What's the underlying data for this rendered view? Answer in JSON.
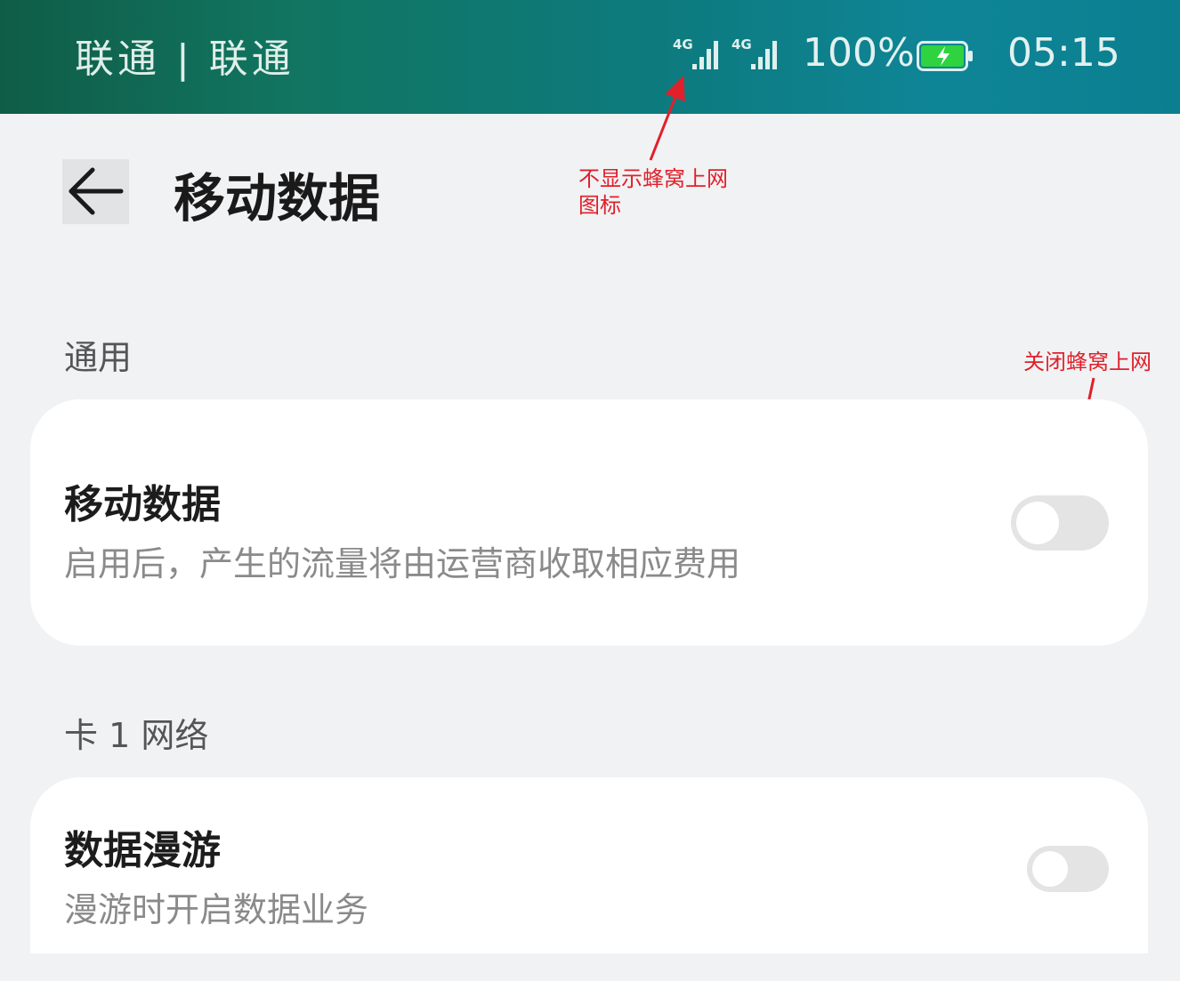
{
  "status_bar": {
    "carrier": "联通 | 联通",
    "signal_1": "4G",
    "signal_2": "4G",
    "battery_percent": "100%",
    "battery_charging": true,
    "time": "05:15"
  },
  "header": {
    "title": "移动数据",
    "back_icon": "back-arrow-icon"
  },
  "annotations": {
    "status_note": "不显示蜂窝上网\n图标",
    "toggle_note": "关闭蜂窝上网"
  },
  "sections": {
    "general": {
      "title": "通用",
      "mobile_data": {
        "title": "移动数据",
        "subtitle": "启用后，产生的流量将由运营商收取相应费用",
        "enabled": false
      }
    },
    "sim1": {
      "title": "卡 1 网络",
      "roaming": {
        "title": "数据漫游",
        "subtitle": "漫游时开启数据业务",
        "enabled": false
      }
    }
  },
  "colors": {
    "annotation": "#e0202a",
    "battery_fill": "#2fd23f",
    "toggle_off_track": "#e4e4e4"
  }
}
